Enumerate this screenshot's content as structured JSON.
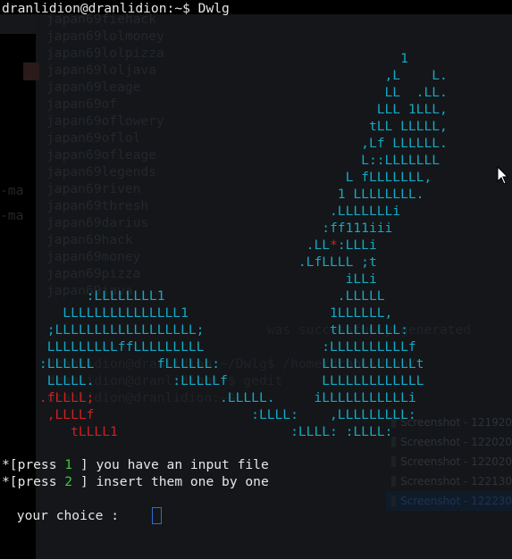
{
  "prompt": {
    "user_host": "dranlidion@dranlidion",
    "path_symbol": ":~$",
    "command": "Dwlg"
  },
  "background": {
    "bg_lines": "japan69fiehack\njapan69lolmoney\njapan69lolpizza\njapan69loljava\njapan69leage\njapan69of\njapan69oflowery\njapan69oflol\njapan69ofleage\njapan69legends\njapan69riven\njapan69thresh\njapan69darius\njapan69hack\njapan69money\njapan69pizza\njapan69java",
    "ruler_1": "-ma",
    "ruler_2": "-ma",
    "center_text": "                                  was successfully generated\n\n      dranlidion@dranlidion:~/Dwlg$ /home/dranlidion/\n      dranlidion@dranlidion:~$ gedit\n      dranlidion@dranlidion:~$",
    "files": [
      "Screenshot - 121920",
      "Screenshot - 122020",
      "Screenshot - 122020",
      "Screenshot - 122130",
      "Screenshot - 122230"
    ],
    "selected_file_index": 4
  },
  "ascii_art": {
    "color": "#15a9c4",
    "accent_color": "#d02020",
    "lines": [
      [
        "                                                   1",
        ""
      ],
      [
        "                                                 ,L    L.",
        ""
      ],
      [
        "                                                 LL  .LL.",
        ""
      ],
      [
        "                                                LLL 1LLL,",
        ""
      ],
      [
        "                                               tLL LLLLL,",
        ""
      ],
      [
        "                                              ,Lf LLLLLL.",
        ""
      ],
      [
        "                                              L::LLLLLLL",
        ""
      ],
      [
        "                                            L fLLLLLLL,",
        ""
      ],
      [
        "                                           1 LLLLLLLL.",
        ""
      ],
      [
        "                                          .LLLLLLLi",
        ""
      ],
      [
        "                                         :ff111iii",
        ""
      ],
      [
        "                                       .LL",
        "*",
        ":LLLi"
      ],
      [
        "                                      .LfLLLL ;t",
        ""
      ],
      [
        "                                            iLLi",
        ""
      ],
      [
        "           :LLLLLLLL1                      .LLLLL",
        ""
      ],
      [
        "        LLLLLLLLLLLLLLL1                  1LLLLLL,",
        ""
      ],
      [
        "      ;LLLLLLLLLLLLLLLLLL;                tLLLLLLLL:",
        ""
      ],
      [
        "      LLLLLLLLLffLLLLLLLLL               :LLLLLLLLLLf",
        ""
      ],
      [
        "     :LLLLLL        fLLLLLL:             LLLLLLLLLLLLt",
        ""
      ],
      [
        "      LLLLL.          :LLLLLf            LLLLLLLLLLLLL",
        ""
      ],
      [
        "",
        ""
      ],
      [
        "",
        ""
      ],
      [
        "",
        ""
      ]
    ],
    "red_left": [
      ".fLLLL;",
      ",LLLLf",
      "tLLLL1"
    ],
    "bottom_lines": [
      "                            .LLLLL.     iLLLLLLLLLLLi",
      "                                :LLLL:    ,LLLLLLLLL:",
      "                                     :LLLL: :LLLL:"
    ]
  },
  "menu": {
    "line1_prefix": "*[press ",
    "line1_num": "1",
    "line1_suffix": " ] you have an input file",
    "line2_prefix": "*[press ",
    "line2_num": "2",
    "line2_suffix": " ] insert them one by one"
  },
  "choice": {
    "label": " your choice :"
  }
}
